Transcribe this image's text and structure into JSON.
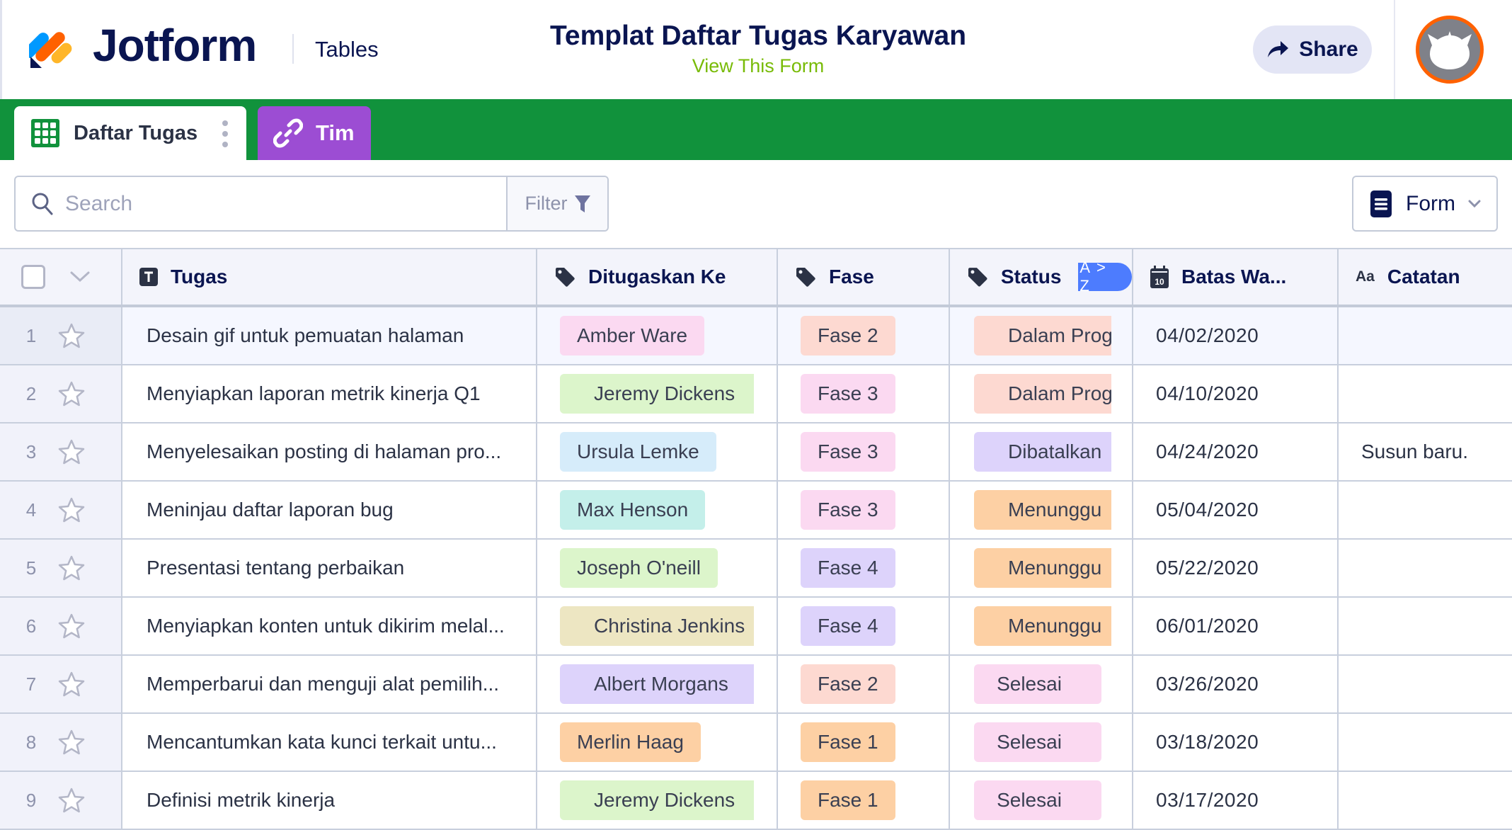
{
  "app": {
    "brand": "Jotform",
    "product": "Tables",
    "title": "Templat Daftar Tugas Karyawan",
    "view_form_link": "View This Form",
    "share_label": "Share",
    "colors": {
      "brand_navy": "#0a1551",
      "tab_strip_green": "#11923c",
      "tim_tab_purple": "#9c4dd3",
      "view_form_green": "#78bb07",
      "avatar_ring": "#ff6100",
      "sort_badge_blue": "#4d7cfe"
    }
  },
  "tabs": [
    {
      "label": "Daftar Tugas",
      "icon": "grid-table-icon",
      "active": true
    },
    {
      "label": "Tim",
      "icon": "link-icon",
      "active": false
    }
  ],
  "toolbar": {
    "search_placeholder": "Search",
    "search_value": "",
    "filter_label": "Filter",
    "form_label": "Form"
  },
  "table": {
    "columns": [
      {
        "label": "Tugas",
        "icon": "text-type-icon"
      },
      {
        "label": "Ditugaskan Ke",
        "icon": "tag-icon"
      },
      {
        "label": "Fase",
        "icon": "tag-icon"
      },
      {
        "label": "Status",
        "icon": "tag-icon",
        "sort_badge": "A > Z"
      },
      {
        "label": "Batas Wa...",
        "icon": "calendar-icon",
        "icon_text": "10"
      },
      {
        "label": "Catatan",
        "icon": "text-aa-icon",
        "icon_text": "Aa"
      }
    ],
    "rows": [
      {
        "num": "1",
        "tugas": "Desain gif untuk pemuatan halaman",
        "assignee": "Amber Ware",
        "assignee_color": "#fbd9f1",
        "fase": "Fase 2",
        "fase_color": "#fdd9d1",
        "status": "Dalam Progr",
        "status_color": "#fdd9d1",
        "date": "04/02/2020",
        "note": ""
      },
      {
        "num": "2",
        "tugas": "Menyiapkan laporan metrik kinerja Q1",
        "assignee": "Jeremy Dickens",
        "assignee_color": "#dcf5cb",
        "fase": "Fase 3",
        "fase_color": "#fbd9f1",
        "status": "Dalam Progr",
        "status_color": "#fdd9d1",
        "date": "04/10/2020",
        "note": ""
      },
      {
        "num": "3",
        "tugas": "Menyelesaikan posting di halaman pro...",
        "assignee": "Ursula Lemke",
        "assignee_color": "#d6ecfa",
        "fase": "Fase 3",
        "fase_color": "#fbd9f1",
        "status": "Dibatalkan",
        "status_color": "#ddd3fb",
        "date": "04/24/2020",
        "note": "Susun baru."
      },
      {
        "num": "4",
        "tugas": "Meninjau daftar laporan bug",
        "assignee": "Max Henson",
        "assignee_color": "#c4efea",
        "fase": "Fase 3",
        "fase_color": "#fbd9f1",
        "status": "Menunggu",
        "status_color": "#fdd0a4",
        "date": "05/04/2020",
        "note": ""
      },
      {
        "num": "5",
        "tugas": "Presentasi tentang perbaikan",
        "assignee": "Joseph O'neill",
        "assignee_color": "#dcf5cb",
        "fase": "Fase 4",
        "fase_color": "#ddd3fb",
        "status": "Menunggu",
        "status_color": "#fdd0a4",
        "date": "05/22/2020",
        "note": ""
      },
      {
        "num": "6",
        "tugas": "Menyiapkan konten untuk dikirim melal...",
        "assignee": "Christina Jenkins",
        "assignee_color": "#ede6c2",
        "fase": "Fase 4",
        "fase_color": "#ddd3fb",
        "status": "Menunggu",
        "status_color": "#fdd0a4",
        "date": "06/01/2020",
        "note": ""
      },
      {
        "num": "7",
        "tugas": "Memperbarui dan menguji alat pemilih...",
        "assignee": "Albert Morgans",
        "assignee_color": "#ddd3fb",
        "fase": "Fase 2",
        "fase_color": "#fdd9d1",
        "status": "Selesai",
        "status_color": "#fbd9f1",
        "date": "03/26/2020",
        "note": ""
      },
      {
        "num": "8",
        "tugas": "Mencantumkan kata kunci terkait untu...",
        "assignee": "Merlin Haag",
        "assignee_color": "#fdd0a4",
        "fase": "Fase 1",
        "fase_color": "#fdd0a4",
        "status": "Selesai",
        "status_color": "#fbd9f1",
        "date": "03/18/2020",
        "note": ""
      },
      {
        "num": "9",
        "tugas": "Definisi metrik kinerja",
        "assignee": "Jeremy Dickens",
        "assignee_color": "#dcf5cb",
        "fase": "Fase 1",
        "fase_color": "#fdd0a4",
        "status": "Selesai",
        "status_color": "#fbd9f1",
        "date": "03/17/2020",
        "note": ""
      }
    ]
  }
}
